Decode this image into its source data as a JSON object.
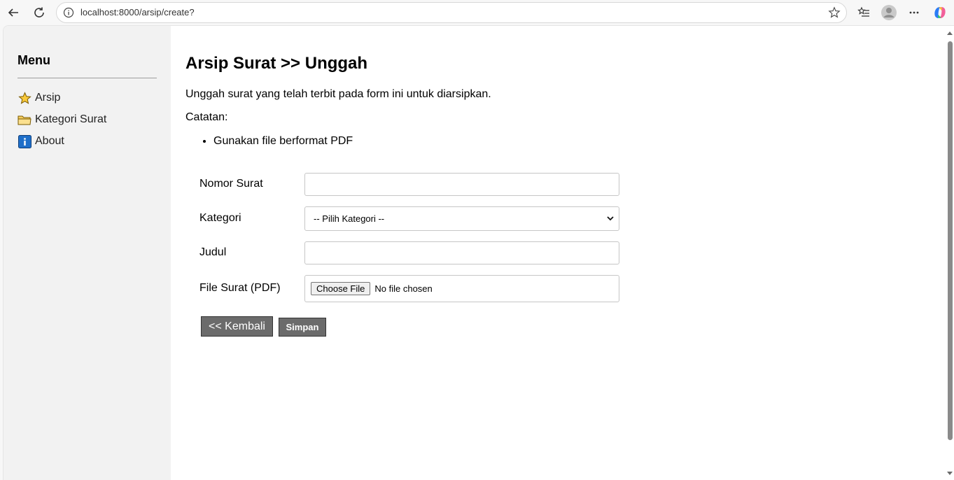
{
  "browser": {
    "url": "localhost:8000/arsip/create?"
  },
  "sidebar": {
    "title": "Menu",
    "items": [
      {
        "label": "Arsip",
        "icon": "star-icon"
      },
      {
        "label": "Kategori Surat",
        "icon": "folder-icon"
      },
      {
        "label": "About",
        "icon": "info-icon"
      }
    ]
  },
  "page": {
    "title": "Arsip Surat >> Unggah",
    "description": "Unggah surat yang telah terbit pada form ini untuk diarsipkan.",
    "note_label": "Catatan:",
    "notes": [
      "Gunakan file berformat PDF"
    ]
  },
  "form": {
    "nomor_label": "Nomor Surat",
    "nomor_value": "",
    "kategori_label": "Kategori",
    "kategori_selected": "-- Pilih Kategori --",
    "judul_label": "Judul",
    "judul_value": "",
    "file_label": "File Surat (PDF)",
    "file_button": "Choose File",
    "file_status": "No file chosen",
    "back_label": "<< Kembali",
    "save_label": "Simpan"
  },
  "colors": {
    "sidebar_bg": "#f2f2f2",
    "button_bg": "#6b6b6b"
  }
}
